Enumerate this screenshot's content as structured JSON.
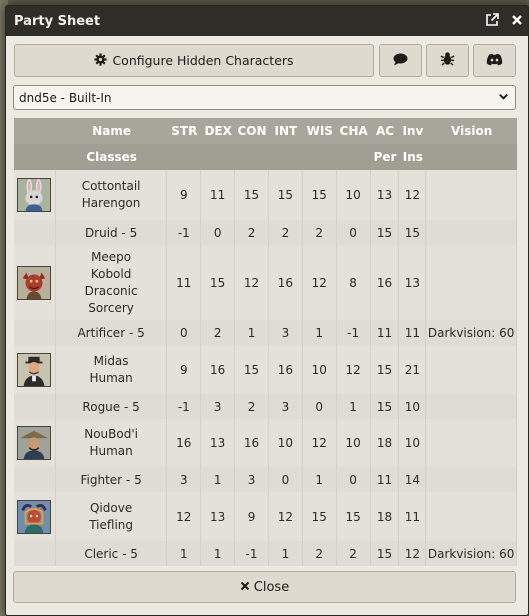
{
  "window": {
    "title": "Party Sheet"
  },
  "toolbar": {
    "configure_label": "Configure Hidden Characters"
  },
  "icons": {
    "config": "gear-icon",
    "chat": "speech-bubble-icon",
    "bug": "bug-icon",
    "discord": "discord-icon",
    "popout": "popout-icon",
    "close": "close-icon"
  },
  "system_select": {
    "value": "dnd5e - Built-In"
  },
  "table": {
    "headers1": [
      "Name",
      "STR",
      "DEX",
      "CON",
      "INT",
      "WIS",
      "CHA",
      "AC",
      "Inv",
      "Vision"
    ],
    "headers2": [
      "Classes",
      "Per",
      "Ins"
    ],
    "characters": [
      {
        "name_lines": [
          "Cottontail",
          "Harengon"
        ],
        "stats": [
          "9",
          "11",
          "15",
          "15",
          "15",
          "10",
          "13",
          "12"
        ],
        "vision": "",
        "class": "Druid - 5",
        "class_stats": [
          "-1",
          "0",
          "2",
          "2",
          "2",
          "0",
          "15",
          "15"
        ],
        "class_vision": ""
      },
      {
        "name_lines": [
          "Meepo",
          "Kobold",
          "Draconic",
          "Sorcery"
        ],
        "stats": [
          "11",
          "15",
          "12",
          "16",
          "12",
          "8",
          "16",
          "13"
        ],
        "vision": "",
        "class": "Artificer - 5",
        "class_stats": [
          "0",
          "2",
          "1",
          "3",
          "1",
          "-1",
          "11",
          "11"
        ],
        "class_vision": "Darkvision: 60"
      },
      {
        "name_lines": [
          "Midas",
          "Human"
        ],
        "stats": [
          "9",
          "16",
          "15",
          "16",
          "10",
          "12",
          "15",
          "21"
        ],
        "vision": "",
        "class": "Rogue - 5",
        "class_stats": [
          "-1",
          "3",
          "2",
          "3",
          "0",
          "1",
          "15",
          "10"
        ],
        "class_vision": ""
      },
      {
        "name_lines": [
          "NouBod'i",
          "Human"
        ],
        "stats": [
          "16",
          "13",
          "16",
          "10",
          "12",
          "10",
          "18",
          "10"
        ],
        "vision": "",
        "class": "Fighter - 5",
        "class_stats": [
          "3",
          "1",
          "3",
          "0",
          "1",
          "0",
          "11",
          "14"
        ],
        "class_vision": ""
      },
      {
        "name_lines": [
          "Qidove",
          "Tiefling"
        ],
        "stats": [
          "12",
          "13",
          "9",
          "12",
          "15",
          "15",
          "18",
          "11"
        ],
        "vision": "",
        "class": "Cleric - 5",
        "class_stats": [
          "1",
          "1",
          "-1",
          "1",
          "2",
          "2",
          "15",
          "12"
        ],
        "class_vision": "Darkvision: 60"
      }
    ]
  },
  "footer": {
    "close_label": "Close"
  }
}
